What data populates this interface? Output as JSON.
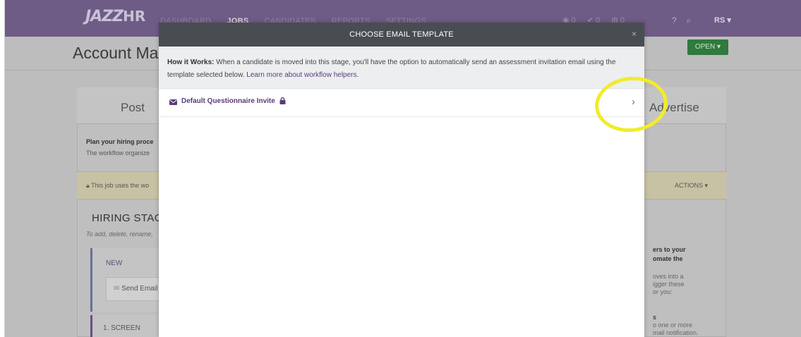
{
  "nav": {
    "logo_main": "JAZZ",
    "logo_suffix": "HR",
    "links": [
      "DASHBOARD",
      "JOBS",
      "CANDIDATES",
      "REPORTS",
      "SETTINGS"
    ],
    "active_link": "JOBS",
    "counters": [
      "0",
      "0",
      "0"
    ],
    "user": "RS ▾"
  },
  "page": {
    "title": "Account Mar",
    "open_button": "OPEN ▾"
  },
  "background": {
    "tab_post": "Post",
    "tab_advertise": "Advertise",
    "plan_title": "Plan your hiring proce",
    "plan_sub": "The workflow organize",
    "warn_text": "This job uses the wo",
    "actions_label": "ACTIONS ▾",
    "stages_title": "HIRING STAGES",
    "stages_sub": "To add, delete, rename,",
    "stage_new": "NEW",
    "send_email": "Send Email",
    "stage_screen": "1. SCREEN",
    "side_bold": [
      "ers to your",
      "omate the"
    ],
    "side_text": [
      "oves into a",
      "igger these",
      "or you:"
    ],
    "side_text2": [
      "s",
      "o one or more",
      "mail notification."
    ]
  },
  "modal": {
    "title": "CHOOSE EMAIL TEMPLATE",
    "close_label": "×",
    "how_bold": "How it Works:",
    "how_text": " When a candidate is moved into this stage, you'll have the option to automatically send an assessment invitation email using the template selected below. ",
    "how_link": "Learn more about workflow helpers.",
    "template_label": "Default Questionnaire Invite",
    "chevron": "›"
  },
  "colors": {
    "brand_purple": "#6e5c86",
    "template_text": "#5a3a78",
    "highlight": "#f1ec2a"
  }
}
